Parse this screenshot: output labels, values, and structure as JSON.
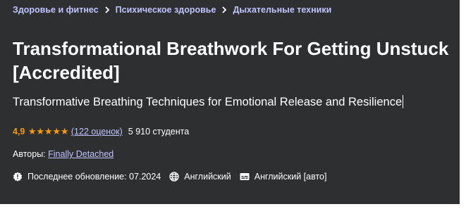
{
  "breadcrumb": [
    {
      "label": "Здоровье и фитнес"
    },
    {
      "label": "Психическое здоровье"
    },
    {
      "label": "Дыхательные техники"
    }
  ],
  "course": {
    "title": "Transformational Breathwork For Getting Unstuck [Accredited]",
    "subtitle": "Transformative Breathing Techniques for Emotional Release and Resilience"
  },
  "rating": {
    "value": "4,9",
    "stars": 5,
    "reviews": "(122 оценок)",
    "students": "5 910 студента"
  },
  "authors": {
    "label": "Авторы:",
    "name": "Finally Detached"
  },
  "meta": {
    "updated": "Последнее обновление: 07.2024",
    "language": "Английский",
    "captions": "Английский [авто]",
    "icons": [
      "alert-badge-icon",
      "globe-icon",
      "captions-icon"
    ]
  },
  "colors": {
    "background": "#2d2f31",
    "link": "#c0c4fc",
    "rating": "#f69c08"
  }
}
